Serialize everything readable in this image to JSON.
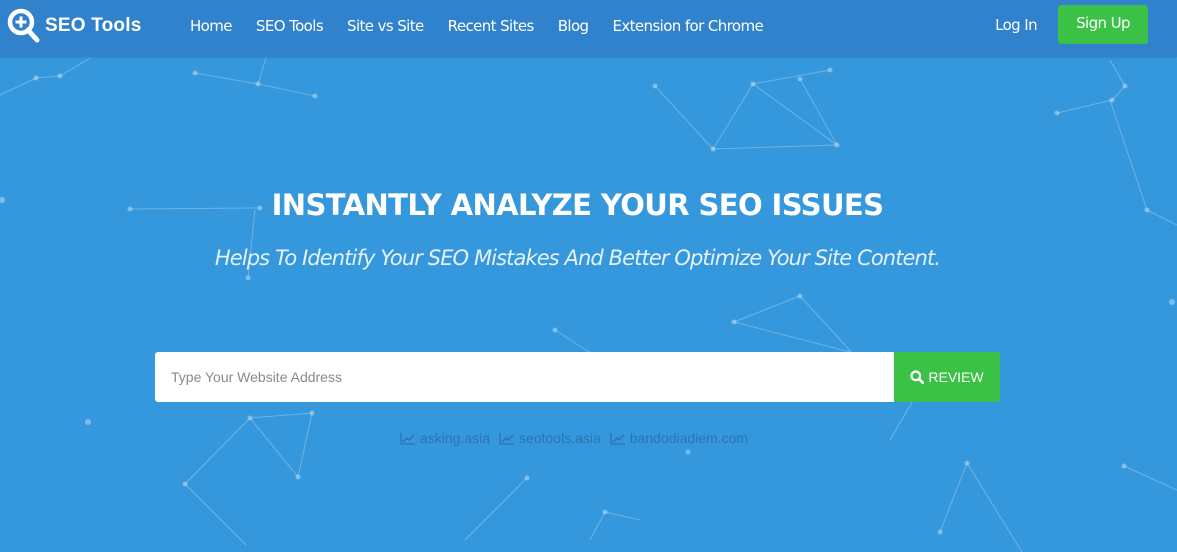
{
  "brand": {
    "name": "SEO Tools",
    "icon": "magnifier-plus-icon"
  },
  "nav": {
    "links": [
      {
        "label": "Home"
      },
      {
        "label": "SEO Tools"
      },
      {
        "label": "Site vs Site"
      },
      {
        "label": "Recent Sites"
      },
      {
        "label": "Blog"
      },
      {
        "label": "Extension for Chrome"
      }
    ],
    "login_label": "Log In",
    "signup_label": "Sign Up"
  },
  "hero": {
    "title": "INSTANTLY ANALYZE YOUR SEO ISSUES",
    "subtitle": "Helps To Identify Your SEO Mistakes And Better Optimize Your Site Content."
  },
  "search": {
    "placeholder": "Type Your Website Address",
    "value": "",
    "button_label": "REVIEW",
    "button_icon": "search-icon"
  },
  "recent_sites": [
    {
      "label": "asking.asia",
      "icon": "line-chart-icon"
    },
    {
      "label": "seotools.asia",
      "icon": "line-chart-icon"
    },
    {
      "label": "bandodiadiem.com",
      "icon": "line-chart-icon"
    }
  ],
  "colors": {
    "navbar": "#3182cc",
    "hero_bg": "#3598dc",
    "accent_green": "#3ac146",
    "recent_link": "#2a6ea8"
  }
}
